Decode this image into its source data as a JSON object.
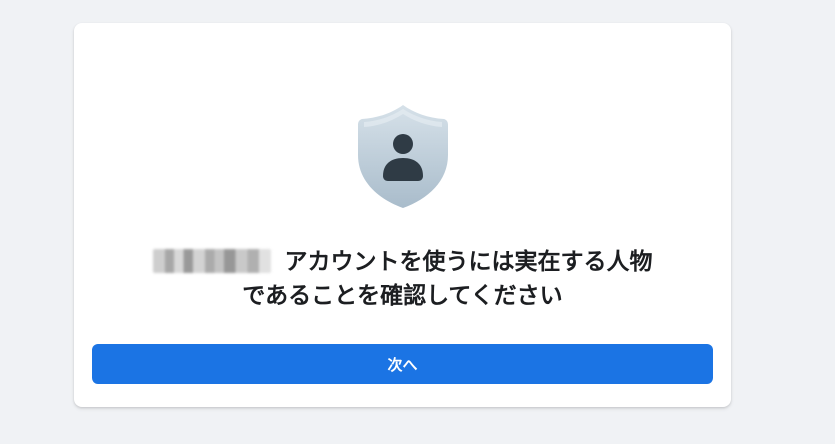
{
  "card": {
    "icon": "shield-person-icon",
    "heading": {
      "name_redacted": "",
      "line1": "アカウントを使うには実在する人物",
      "line2": "であることを確認してください"
    },
    "next_button_label": "次へ"
  },
  "colors": {
    "page_background": "#f0f2f5",
    "card_background": "#ffffff",
    "primary_button": "#1b74e4",
    "heading_text": "#1c1e21"
  }
}
